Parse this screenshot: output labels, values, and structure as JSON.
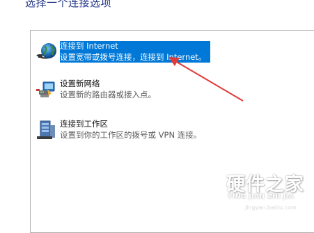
{
  "page": {
    "title": "选择一个连接选项"
  },
  "options": [
    {
      "title": "连接到 Internet",
      "description": "设置宽带或拨号连接，连接到 Internet。",
      "selected": true,
      "icon": "globe-network-icon"
    },
    {
      "title": "设置新网络",
      "description": "设置新的路由器或接入点。",
      "selected": false,
      "icon": "router-setup-icon"
    },
    {
      "title": "连接到工作区",
      "description": "设置到你的工作区的拨号或 VPN 连接。",
      "selected": false,
      "icon": "workplace-server-icon"
    }
  ],
  "watermark": {
    "name": "硬件之家",
    "pinyin": "YING JIAN ZHI JIA",
    "url": "jingyan.baidu.com"
  },
  "colors": {
    "selection": "#0078d7",
    "title": "#1e3287",
    "annotation_arrow": "#e03a3a"
  }
}
